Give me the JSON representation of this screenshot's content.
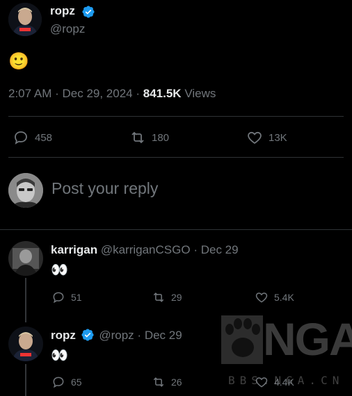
{
  "main_tweet": {
    "display_name": "ropz",
    "handle": "@ropz",
    "content": "🙂",
    "time": "2:07 AM",
    "date": "Dec 29, 2024",
    "views_count": "841.5K",
    "views_label": "Views",
    "replies": "458",
    "reposts": "180",
    "likes": "13K"
  },
  "composer": {
    "placeholder": "Post your reply"
  },
  "replies": [
    {
      "display_name": "karrigan",
      "handle": "@karriganCSGO",
      "date": "Dec 29",
      "content": "👀",
      "replies": "51",
      "reposts": "29",
      "likes": "5.4K"
    },
    {
      "display_name": "ropz",
      "handle": "@ropz",
      "date": "Dec 29",
      "content": "👀",
      "replies": "65",
      "reposts": "26",
      "likes": "4.4K"
    }
  ],
  "watermark": {
    "logo_text": "NGA",
    "domain_text": "BBS.NGA.CN"
  },
  "colors": {
    "verified": "#1d9bf0",
    "muted": "#71767b",
    "divider": "#2f3336"
  }
}
